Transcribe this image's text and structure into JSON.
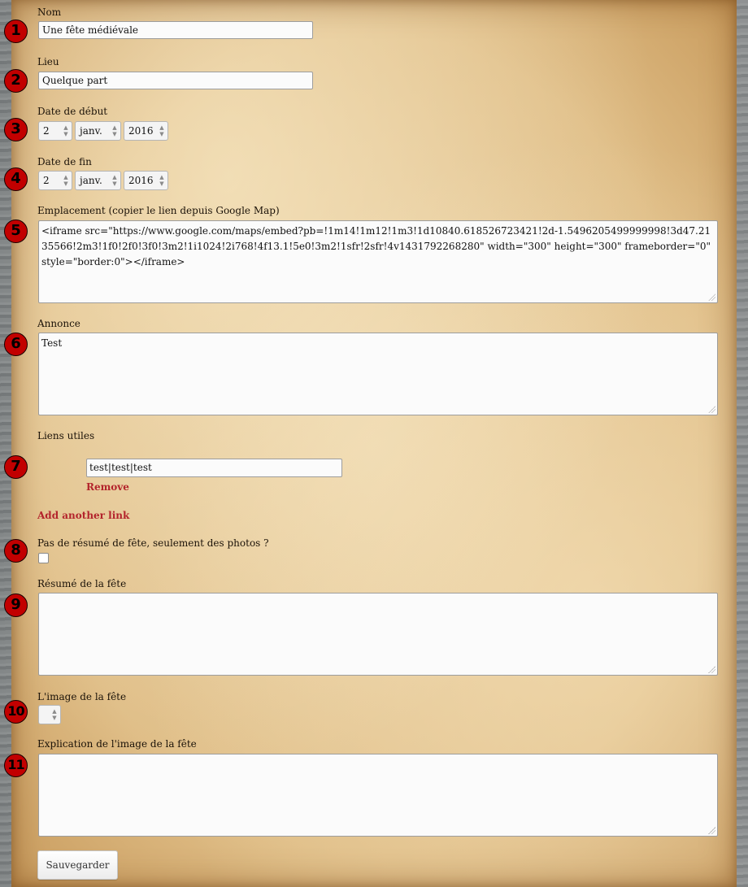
{
  "fields": {
    "nom": {
      "number": "1",
      "label": "Nom",
      "value": "Une fête médiévale"
    },
    "lieu": {
      "number": "2",
      "label": "Lieu",
      "value": "Quelque part"
    },
    "date_debut": {
      "number": "3",
      "label": "Date de début",
      "day": "2",
      "month": "janv.",
      "year": "2016"
    },
    "date_fin": {
      "number": "4",
      "label": "Date de fin",
      "day": "2",
      "month": "janv.",
      "year": "2016"
    },
    "emplacement": {
      "number": "5",
      "label": "Emplacement (copier le lien depuis Google Map)",
      "value": "<iframe src=\"https://www.google.com/maps/embed?pb=!1m14!1m12!1m3!1d10840.618526723421!2d-1.5496205499999998!3d47.2135566!2m3!1f0!2f0!3f0!3m2!1i1024!2i768!4f13.1!5e0!3m2!1sfr!2sfr!4v1431792268280\" width=\"300\" height=\"300\" frameborder=\"0\" style=\"border:0\"></iframe>"
    },
    "annonce": {
      "number": "6",
      "label": "Annonce",
      "value": "Test"
    },
    "liens": {
      "number": "7",
      "label": "Liens utiles",
      "value": "test|test|test",
      "remove_label": "Remove",
      "add_label": "Add another link"
    },
    "pas_resume": {
      "number": "8",
      "label": "Pas de résumé de fête, seulement des photos ?",
      "checked": false
    },
    "resume": {
      "number": "9",
      "label": "Résumé de la fête",
      "value": ""
    },
    "image": {
      "number": "10",
      "label": "L'image de la fête",
      "value": ""
    },
    "explication": {
      "number": "11",
      "label": "Explication de l'image de la fête",
      "value": ""
    }
  },
  "save_button": "Sauvegarder",
  "colors": {
    "badge": "#c20000",
    "link": "#b3242c",
    "parchment": "#dfbd86"
  }
}
